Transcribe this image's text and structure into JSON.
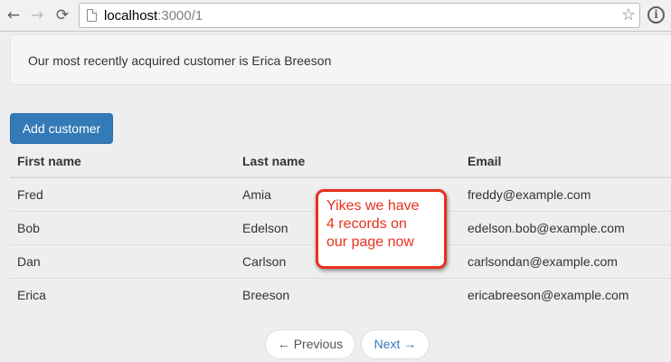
{
  "browser": {
    "url_host": "localhost",
    "url_path": ":3000/1",
    "back_icon": "back-arrow-icon",
    "forward_icon": "forward-arrow-icon",
    "reload_icon": "reload-icon",
    "page_icon": "page-icon",
    "bookmark_icon": "star-icon",
    "info_icon": "info-icon",
    "info_glyph": "i"
  },
  "panel": {
    "text": "Our most recently acquired customer is Erica Breeson"
  },
  "actions": {
    "add_customer_label": "Add customer"
  },
  "table": {
    "headers": [
      "First name",
      "Last name",
      "Email"
    ],
    "rows": [
      [
        "Fred",
        "Amia",
        "freddy@example.com"
      ],
      [
        "Bob",
        "Edelson",
        "edelson.bob@example.com"
      ],
      [
        "Dan",
        "Carlson",
        "carlsondan@example.com"
      ],
      [
        "Erica",
        "Breeson",
        "ericabreeson@example.com"
      ]
    ]
  },
  "callout": {
    "lines": [
      "Yikes we have",
      "4 records on",
      "our page now"
    ],
    "color": "#e8301c"
  },
  "pagination": {
    "previous_label": "← Previous",
    "next_label": "Next →"
  },
  "colors": {
    "primary": "#337ab7",
    "background": "#eeeeee"
  }
}
